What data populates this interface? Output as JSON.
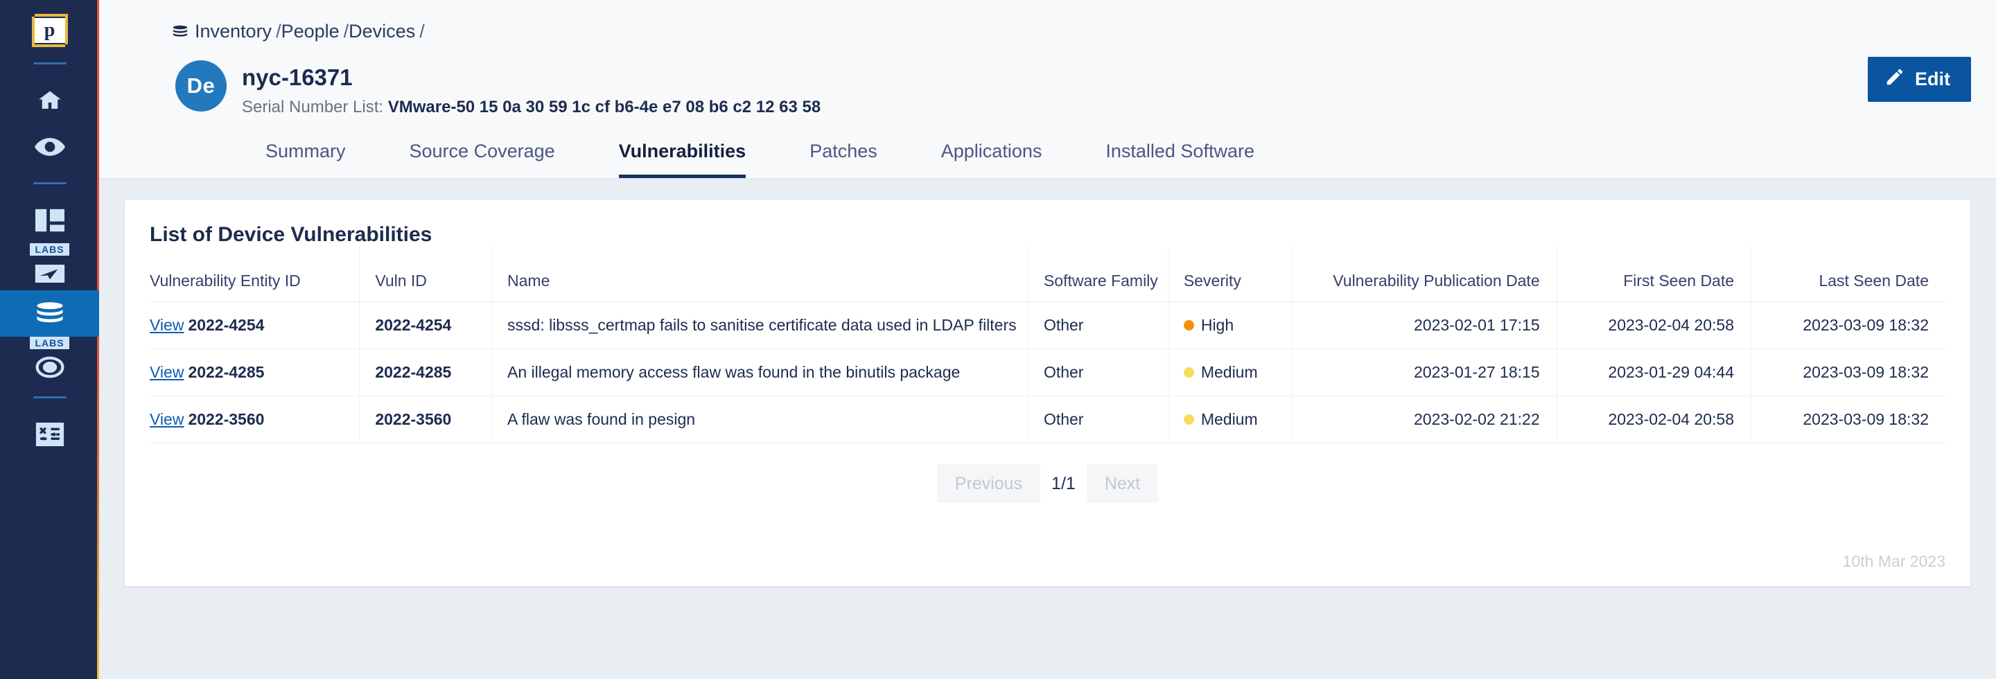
{
  "sidebar": {
    "logo_letter": "p",
    "labs_badge": "LABS",
    "items": [
      {
        "name": "home",
        "icon": "home-icon",
        "labs": false,
        "active": false
      },
      {
        "name": "visibility",
        "icon": "eye-icon",
        "labs": false,
        "active": false
      },
      {
        "name": "dashboard",
        "icon": "dashboard-icon",
        "labs": false,
        "active": false
      },
      {
        "name": "explore",
        "icon": "mouse-pointer-icon",
        "labs": true,
        "active": false
      },
      {
        "name": "inventory",
        "icon": "database-icon",
        "labs": false,
        "active": true
      },
      {
        "name": "observability",
        "icon": "target-icon",
        "labs": true,
        "active": false
      },
      {
        "name": "integrations",
        "icon": "plugin-icon",
        "labs": false,
        "active": false
      }
    ]
  },
  "breadcrumb": {
    "icon": "database-icon",
    "items": [
      "Inventory",
      "People",
      "Devices"
    ],
    "separator": "/",
    "trailing": "/"
  },
  "device": {
    "avatar_initials": "De",
    "title": "nyc-16371",
    "serial_label": "Serial Number List:",
    "serial_value": "VMware-50 15 0a 30 59 1c cf b6-4e e7 08 b6 c2 12 63 58"
  },
  "edit_button": {
    "label": "Edit",
    "icon": "pencil-icon",
    "color": "#0a54a0"
  },
  "tabs": [
    {
      "label": "Summary",
      "active": false
    },
    {
      "label": "Source Coverage",
      "active": false
    },
    {
      "label": "Vulnerabilities",
      "active": true
    },
    {
      "label": "Patches",
      "active": false
    },
    {
      "label": "Applications",
      "active": false
    },
    {
      "label": "Installed Software",
      "active": false
    }
  ],
  "card": {
    "title": "List of Device Vulnerabilities",
    "columns": [
      "Vulnerability Entity ID",
      "Vuln ID",
      "Name",
      "Software Family",
      "Severity",
      "Vulnerability Publication Date",
      "First Seen Date",
      "Last Seen Date"
    ],
    "rows": [
      {
        "view": "View",
        "entity_id": "2022-4254",
        "vuln_id": "2022-4254",
        "name": "sssd: libsss_certmap fails to sanitise certificate data used in LDAP filters",
        "software_family": "Other",
        "severity": "High",
        "severity_color": "#f79009",
        "publication_date": "2023-02-01 17:15",
        "first_seen": "2023-02-04 20:58",
        "last_seen": "2023-03-09 18:32"
      },
      {
        "view": "View",
        "entity_id": "2022-4285",
        "vuln_id": "2022-4285",
        "name": "An illegal memory access flaw was found in the binutils package",
        "software_family": "Other",
        "severity": "Medium",
        "severity_color": "#fada5e",
        "publication_date": "2023-01-27 18:15",
        "first_seen": "2023-01-29 04:44",
        "last_seen": "2023-03-09 18:32"
      },
      {
        "view": "View",
        "entity_id": "2022-3560",
        "vuln_id": "2022-3560",
        "name": "A flaw was found in pesign",
        "software_family": "Other",
        "severity": "Medium",
        "severity_color": "#fada5e",
        "publication_date": "2023-02-02 21:22",
        "first_seen": "2023-02-04 20:58",
        "last_seen": "2023-03-09 18:32"
      }
    ],
    "pagination": {
      "previous": "Previous",
      "indicator": "1/1",
      "next": "Next"
    },
    "footer_date": "10th Mar 2023"
  }
}
